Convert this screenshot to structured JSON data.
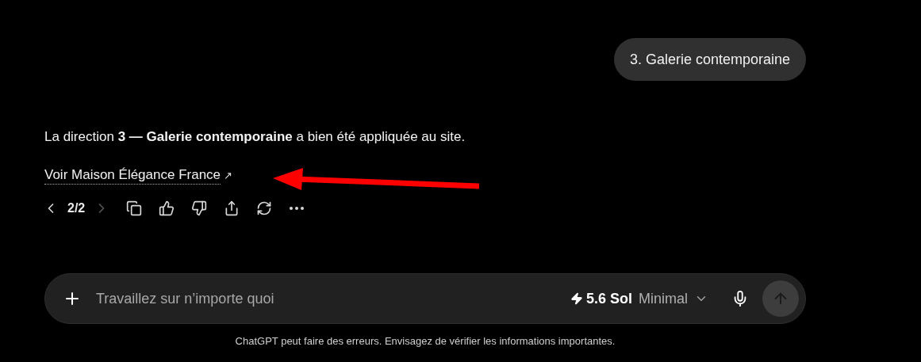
{
  "user_message": "3. Galerie contemporaine",
  "assistant": {
    "text": "La direction **3 — Galerie contemporaine** a bien été appliquée au site.",
    "link": "Voir Maison Élégance France",
    "link_icon": "↗"
  },
  "actions": {
    "pager": "2/2",
    "prev_disabled": false,
    "next_disabled": true
  },
  "composer": {
    "placeholder": "Travaillez sur n’importe quoi",
    "model": {
      "name": "5.6 Sol",
      "mode": "Minimal"
    },
    "send_disabled": true
  },
  "footer": "ChatGPT peut faire des erreurs. Envisagez de vérifier les informations importantes."
}
